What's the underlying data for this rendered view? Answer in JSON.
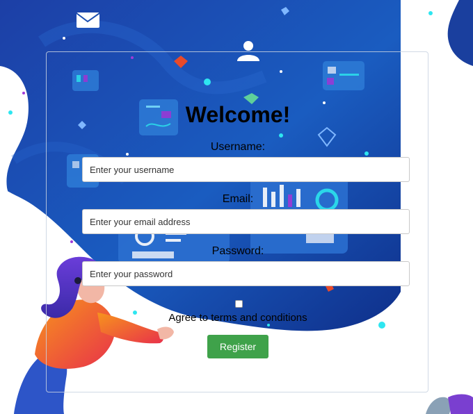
{
  "form": {
    "title": "Welcome!",
    "username_label": "Username:",
    "username_placeholder": "Enter your username",
    "email_label": "Email:",
    "email_placeholder": "Enter your email address",
    "password_label": "Password:",
    "password_placeholder": "Enter your password",
    "terms_label": "Agree to terms and conditions",
    "register_label": "Register"
  },
  "colors": {
    "background_blue": "#1a4fb0",
    "accent_cyan": "#2ee6f0",
    "register_button": "#3fa24a"
  },
  "background": {
    "icons": [
      "envelope-icon",
      "user-icon",
      "dashboard-panel-icon",
      "chart-panel-icon",
      "cube-icon"
    ],
    "illustration": "woman-with-purple-hair"
  }
}
